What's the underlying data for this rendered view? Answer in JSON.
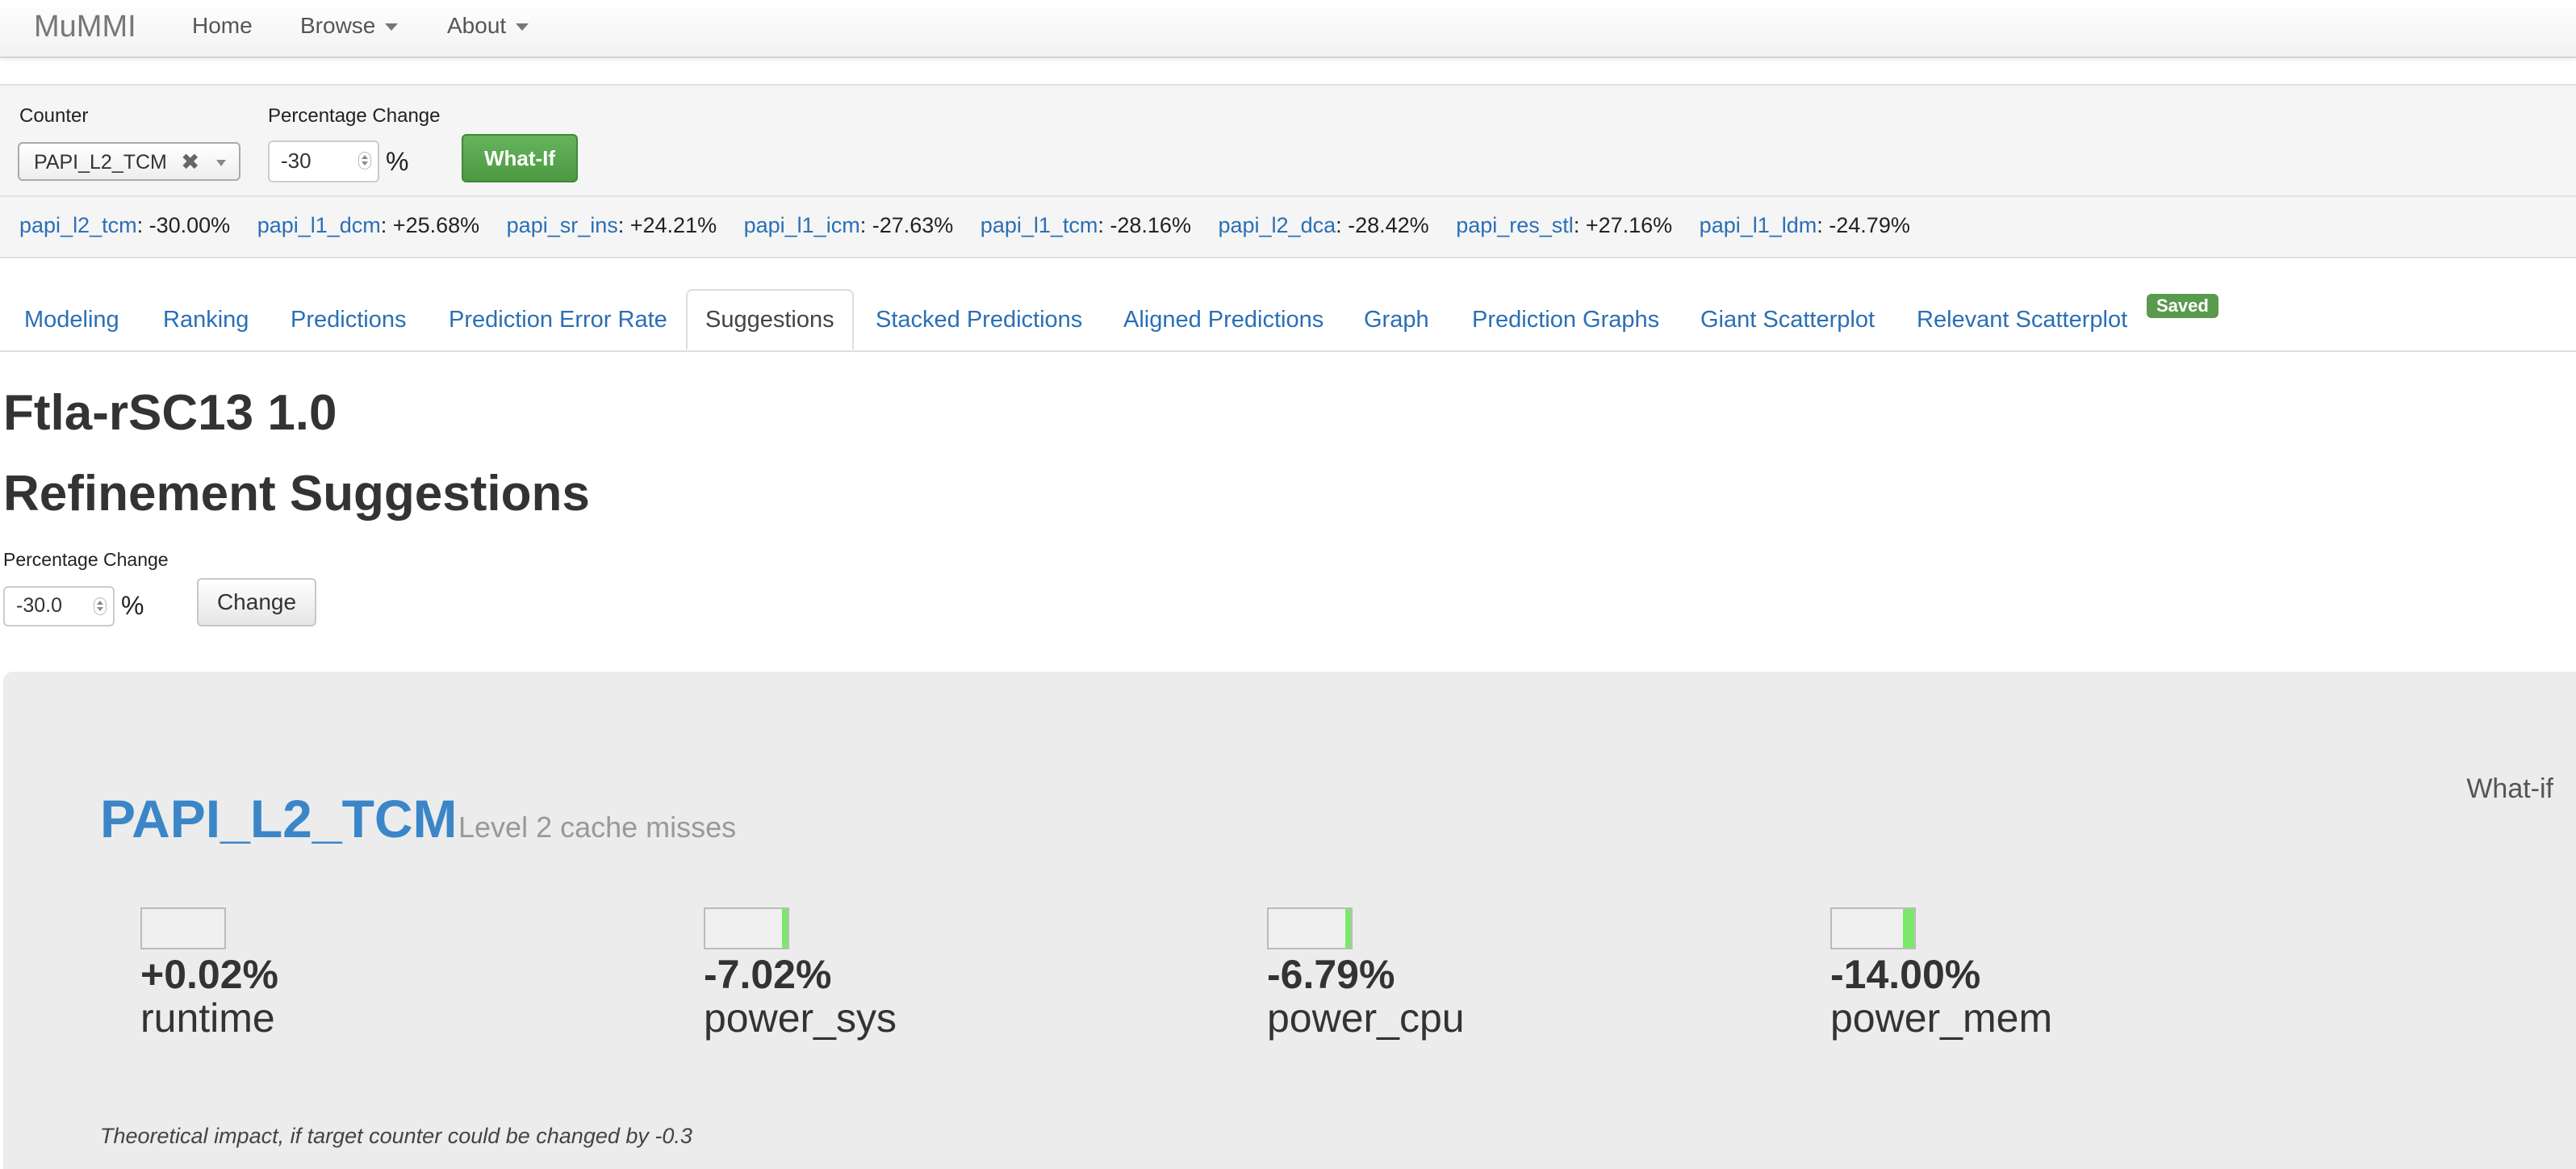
{
  "navbar": {
    "brand": "MuMMI",
    "items": [
      {
        "label": "Home"
      },
      {
        "label": "Browse"
      },
      {
        "label": "About"
      }
    ]
  },
  "whatif": {
    "counter_label": "Counter",
    "counter_value": "PAPI_L2_TCM",
    "pct_label": "Percentage Change",
    "pct_value": "-30",
    "pct_symbol": "%",
    "button": "What-If",
    "stats": [
      {
        "name": "papi_l2_tcm",
        "value": ": -30.00%"
      },
      {
        "name": "papi_l1_dcm",
        "value": ": +25.68%"
      },
      {
        "name": "papi_sr_ins",
        "value": ": +24.21%"
      },
      {
        "name": "papi_l1_icm",
        "value": ": -27.63%"
      },
      {
        "name": "papi_l1_tcm",
        "value": ": -28.16%"
      },
      {
        "name": "papi_l2_dca",
        "value": ": -28.42%"
      },
      {
        "name": "papi_res_stl",
        "value": ": +27.16%"
      },
      {
        "name": "papi_l1_ldm",
        "value": ": -24.79%"
      }
    ]
  },
  "tabs": [
    {
      "label": "Modeling"
    },
    {
      "label": "Ranking"
    },
    {
      "label": "Predictions"
    },
    {
      "label": "Prediction Error Rate"
    },
    {
      "label": "Suggestions",
      "active": true
    },
    {
      "label": "Stacked Predictions"
    },
    {
      "label": "Aligned Predictions"
    },
    {
      "label": "Graph"
    },
    {
      "label": "Prediction Graphs"
    },
    {
      "label": "Giant Scatterplot"
    },
    {
      "label": "Relevant Scatterplot"
    }
  ],
  "saved_badge": "Saved",
  "page": {
    "title": "Ftla-rSC13 1.0",
    "subtitle": "Refinement Suggestions",
    "pct_label": "Percentage Change",
    "pct_value": "-30.0",
    "pct_symbol": "%",
    "change_button": "Change"
  },
  "panel": {
    "counter": "PAPI_L2_TCM",
    "description": "Level 2 cache misses",
    "whatif_label": "What-if",
    "metrics": [
      {
        "value": "+0.02%",
        "name": "runtime",
        "bar_fraction": 0.0002
      },
      {
        "value": "-7.02%",
        "name": "power_sys",
        "bar_fraction": 0.0702
      },
      {
        "value": "-6.79%",
        "name": "power_cpu",
        "bar_fraction": 0.0679
      },
      {
        "value": "-14.00%",
        "name": "power_mem",
        "bar_fraction": 0.14
      }
    ],
    "bar_color": "#7be86a",
    "footnote": "Theoretical impact, if target counter could be changed by -0.3"
  }
}
